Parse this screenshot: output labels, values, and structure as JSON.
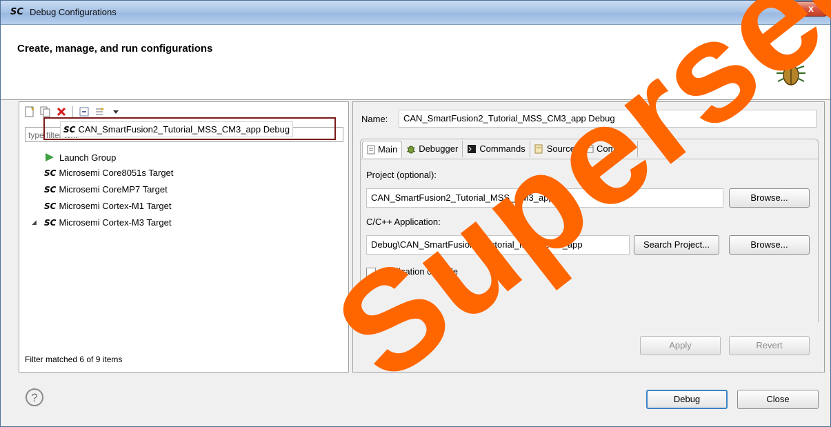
{
  "window": {
    "app_icon": "SC",
    "title": "Debug Configurations",
    "close_label": "x"
  },
  "header": {
    "heading": "Create, manage, and run configurations",
    "icon": "bug-icon"
  },
  "left": {
    "toolbar": [
      "new-configuration-icon",
      "duplicate-icon",
      "delete-icon",
      "collapse-all-icon",
      "filter-icon",
      "dropdown-arrow-icon"
    ],
    "filter_placeholder": "type filter text",
    "tree": [
      {
        "label": "Launch Group",
        "icon": "launch-icon"
      },
      {
        "label": "Microsemi Core8051s Target",
        "icon": "SC"
      },
      {
        "label": "Microsemi CoreMP7 Target",
        "icon": "SC"
      },
      {
        "label": "Microsemi Cortex-M1 Target",
        "icon": "SC"
      },
      {
        "label": "Microsemi Cortex-M3 Target",
        "icon": "SC",
        "expander": "◢"
      },
      {
        "label": "CAN_SmartFusion2_Tutorial_MSS_CM3_app Debug",
        "icon": "SC"
      }
    ],
    "status": "Filter matched 6 of 9 items"
  },
  "right": {
    "name_label": "Name:",
    "name_value": "CAN_SmartFusion2_Tutorial_MSS_CM3_app Debug",
    "tabs": [
      {
        "label": "Main",
        "icon": "main-tab-icon"
      },
      {
        "label": "Debugger",
        "icon": "debugger-icon"
      },
      {
        "label": "Commands",
        "icon": "commands-icon"
      },
      {
        "label": "Source",
        "icon": "source-icon"
      },
      {
        "label": "Common",
        "icon": "common-icon"
      }
    ],
    "project_label": "Project (optional):",
    "project_value": "CAN_SmartFusion2_Tutorial_MSS_CM3_app",
    "browse_label": "Browse...",
    "app_label": "C/C++ Application:",
    "app_value": "Debug\\CAN_SmartFusion2_Tutorial_MSS_CM3_app",
    "search_project_label": "Search Project...",
    "console_label": "Application console",
    "apply_label": "Apply",
    "revert_label": "Revert"
  },
  "footer": {
    "help_label": "?",
    "debug_label": "Debug",
    "close_label": "Close"
  },
  "watermark": {
    "text": "Superseded",
    "color": "#ff6600"
  }
}
